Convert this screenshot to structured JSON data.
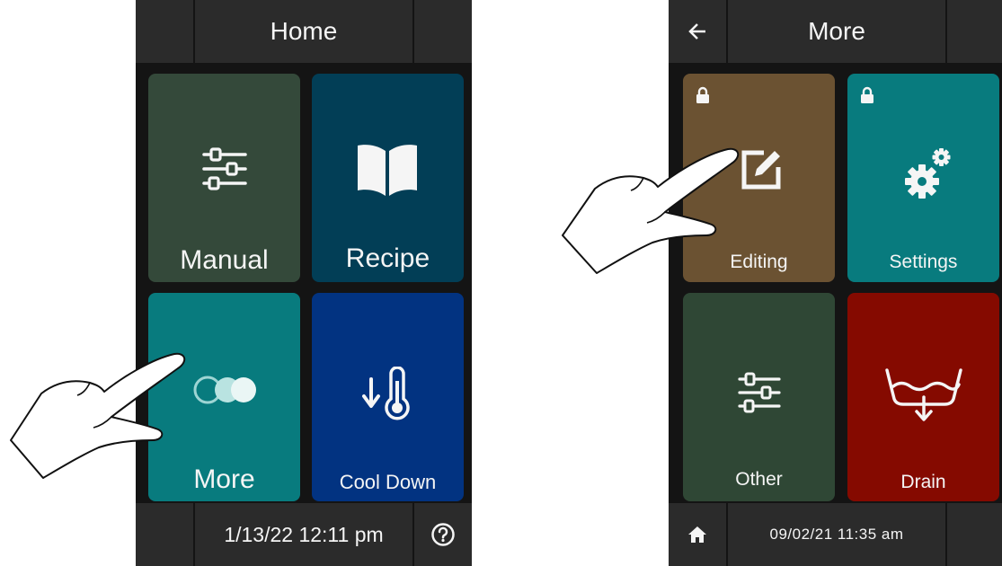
{
  "home": {
    "title": "Home",
    "datetime": "1/13/22 12:11 pm",
    "tiles": [
      {
        "label": "Manual",
        "icon": "sliders-icon",
        "color": "#34493a"
      },
      {
        "label": "Recipe",
        "icon": "book-icon",
        "color": "#023e56"
      },
      {
        "label": "More",
        "icon": "toggle-circles-icon",
        "color": "#087b7e"
      },
      {
        "label": "Cool Down",
        "icon": "thermometer-down-icon",
        "color": "#023381"
      }
    ],
    "help_icon": "question-circle-icon"
  },
  "more": {
    "title": "More",
    "datetime": "09/02/21  11:35 am",
    "back_icon": "arrow-left-icon",
    "home_icon": "home-icon",
    "tiles": [
      {
        "label": "Editing",
        "icon": "edit-icon",
        "color": "#6b5232",
        "locked": true
      },
      {
        "label": "Settings",
        "icon": "gears-icon",
        "color": "#087b7e",
        "locked": true
      },
      {
        "label": "Other",
        "icon": "sliders-icon",
        "color": "#2f4735",
        "locked": false
      },
      {
        "label": "Drain",
        "icon": "drain-icon",
        "color": "#850a00",
        "locked": false
      }
    ]
  }
}
